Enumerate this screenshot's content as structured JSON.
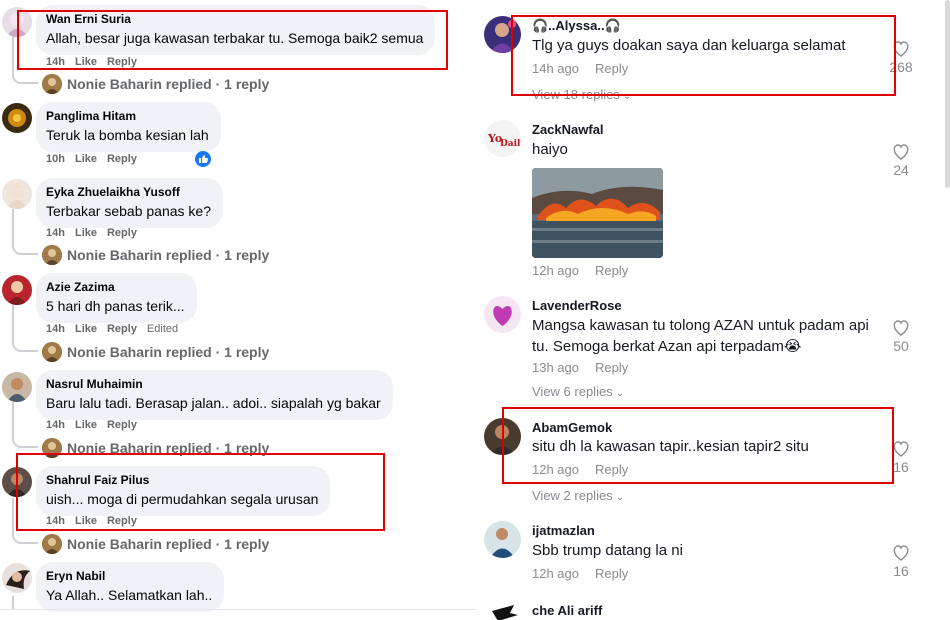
{
  "left_panel": {
    "comments": [
      {
        "author": "Wan Erni Suria",
        "text": "Allah, besar juga kawasan terbakar tu. Semoga baik2 semua",
        "time": "14h",
        "like": "Like",
        "reply": "Reply",
        "replies_link": "Nonie Baharin replied · 1 reply"
      },
      {
        "author": "Panglima Hitam",
        "text": "Teruk la bomba kesian lah",
        "time": "10h",
        "like": "Like",
        "reply": "Reply"
      },
      {
        "author": "Eyka Zhuelaikha Yusoff",
        "text": "Terbakar sebab panas ke?",
        "time": "14h",
        "like": "Like",
        "reply": "Reply",
        "replies_link": "Nonie Baharin replied · 1 reply"
      },
      {
        "author": "Azie Zazima",
        "text": "5 hari dh panas terik...",
        "time": "14h",
        "like": "Like",
        "reply": "Reply",
        "edited": "Edited",
        "replies_link": "Nonie Baharin replied · 1 reply"
      },
      {
        "author": "Nasrul Muhaimin",
        "text": "Baru lalu tadi. Berasap jalan.. adoi.. siapalah yg bakar",
        "time": "14h",
        "like": "Like",
        "reply": "Reply",
        "replies_link": "Nonie Baharin replied · 1 reply"
      },
      {
        "author": "Shahrul Faiz Pilus",
        "text": "uish... moga di permudahkan segala urusan",
        "time": "14h",
        "like": "Like",
        "reply": "Reply",
        "replies_link": "Nonie Baharin replied · 1 reply"
      },
      {
        "author": "Eryn Nabil",
        "text": "Ya Allah.. Selamatkan lah.."
      }
    ]
  },
  "right_panel": {
    "comments": [
      {
        "author": "🎧..Alyssa..🎧",
        "text": "Tlg ya guys doakan saya dan keluarga selamat",
        "time": "14h ago",
        "reply": "Reply",
        "likes": "268",
        "view_replies": "View 18 replies"
      },
      {
        "author": "ZackNawfal",
        "text": "haiyo",
        "time": "12h ago",
        "reply": "Reply",
        "likes": "24"
      },
      {
        "author": "LavenderRose",
        "text_line1": "Mangsa kawasan tu tolong AZAN untuk padam api",
        "text_line2": "tu. Semoga berkat Azan api terpadam😭",
        "time": "13h ago",
        "reply": "Reply",
        "likes": "50",
        "view_replies": "View 6 replies"
      },
      {
        "author": "AbamGemok",
        "text": "situ dh la kawasan tapir..kesian tapir2 situ",
        "time": "12h ago",
        "reply": "Reply",
        "likes": "16",
        "view_replies": "View 2 replies"
      },
      {
        "author": "ijatmazlan",
        "text": "Sbb trump datang la ni",
        "time": "12h ago",
        "reply": "Reply",
        "likes": "16"
      },
      {
        "author": "che Ali ariff"
      }
    ]
  },
  "colors": {
    "highlight": "#e00000",
    "fb_bubble": "#f0f2f5",
    "fb_secondary": "#65676b",
    "tt_secondary": "#8a8b91",
    "fb_like_blue": "#1877f2"
  },
  "icons": [
    "heart-icon",
    "chevron-down-icon",
    "like-thumb-icon"
  ]
}
